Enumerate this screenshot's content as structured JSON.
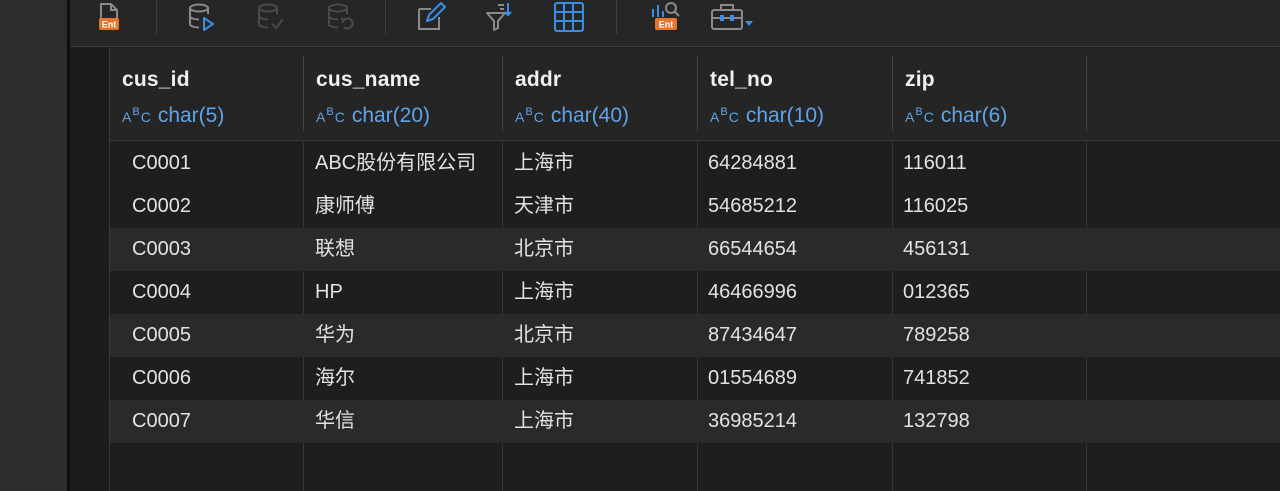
{
  "toolbar": {
    "buttons": [
      {
        "icon": "export-ent-icon",
        "label": "Ent"
      },
      {
        "icon": "run-db-icon"
      },
      {
        "icon": "commit-db-icon"
      },
      {
        "icon": "rollback-db-icon"
      },
      {
        "icon": "edit-icon"
      },
      {
        "icon": "filter-sort-icon"
      },
      {
        "icon": "grid-icon"
      },
      {
        "icon": "explain-ent-icon",
        "label": "Ent"
      },
      {
        "icon": "toolbox-icon"
      }
    ]
  },
  "table": {
    "columns": [
      {
        "name": "cus_id",
        "type": "char(5)"
      },
      {
        "name": "cus_name",
        "type": "char(20)"
      },
      {
        "name": "addr",
        "type": "char(40)"
      },
      {
        "name": "tel_no",
        "type": "char(10)"
      },
      {
        "name": "zip",
        "type": "char(6)"
      }
    ],
    "type_prefix": "ABC",
    "rows": [
      [
        "C0001",
        "ABC股份有限公司",
        "上海市",
        "64284881",
        "116011"
      ],
      [
        "C0002",
        "康师傅",
        "天津市",
        "54685212",
        "116025"
      ],
      [
        "C0003",
        "联想",
        "北京市",
        "66544654",
        "456131"
      ],
      [
        "C0004",
        "HP",
        "上海市",
        "46466996",
        "012365"
      ],
      [
        "C0005",
        "华为",
        "北京市",
        "87434647",
        "789258"
      ],
      [
        "C0006",
        "海尔",
        "上海市",
        "01554689",
        "741852"
      ],
      [
        "C0007",
        "华信",
        "上海市",
        "36985214",
        "132798"
      ]
    ]
  },
  "colors": {
    "background": "#1e1e1e",
    "type_text": "#5fa3e8",
    "icon": "#8a8a8a",
    "accent_orange": "#e8742a",
    "accent_blue": "#3b8ee8"
  }
}
